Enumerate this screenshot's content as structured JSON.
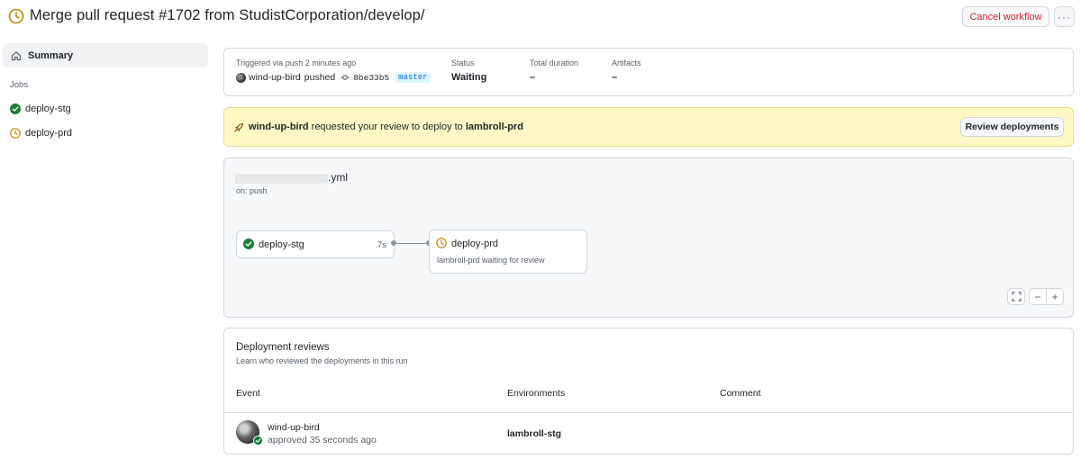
{
  "header": {
    "title": "Merge pull request #1702 from StudistCorporation/develop/",
    "cancel_label": "Cancel workflow",
    "more_label": "···"
  },
  "sidebar": {
    "summary_label": "Summary",
    "jobs_heading": "Jobs",
    "jobs": [
      {
        "label": "deploy-stg",
        "status": "success"
      },
      {
        "label": "deploy-prd",
        "status": "waiting"
      }
    ]
  },
  "summary": {
    "triggered_label": "Triggered via push 2 minutes ago",
    "actor": "wind-up-bird",
    "action": "pushed",
    "commit_sha": "8be33b5",
    "branch": "master",
    "status_label": "Status",
    "status_value": "Waiting",
    "duration_label": "Total duration",
    "duration_value": "–",
    "artifacts_label": "Artifacts",
    "artifacts_value": "–"
  },
  "review_banner": {
    "user": "wind-up-bird",
    "message": " requested your review to deploy to ",
    "environment": "lambroll-prd",
    "button_label": "Review deployments"
  },
  "graph": {
    "file_ext": ".yml",
    "trigger": "on: push",
    "jobs": [
      {
        "name": "deploy-stg",
        "time": "7s",
        "status": "success"
      },
      {
        "name": "deploy-prd",
        "env": "lambroll-prd",
        "sub": " waiting for review",
        "status": "waiting"
      }
    ],
    "zoom_out_label": "−",
    "zoom_in_label": "+"
  },
  "deployment_reviews": {
    "title": "Deployment reviews",
    "subtitle": "Learn who reviewed the deployments in this run",
    "columns": [
      "Event",
      "Environments",
      "Comment"
    ],
    "rows": [
      {
        "user": "wind-up-bird",
        "event": "approved 35 seconds ago",
        "environment": "lambroll-stg",
        "comment": ""
      }
    ]
  },
  "colors": {
    "success": "#1a7f37",
    "waiting": "#bf8700",
    "danger": "#cf222e",
    "link": "#0969da",
    "banner_bg": "#fff8c5"
  }
}
